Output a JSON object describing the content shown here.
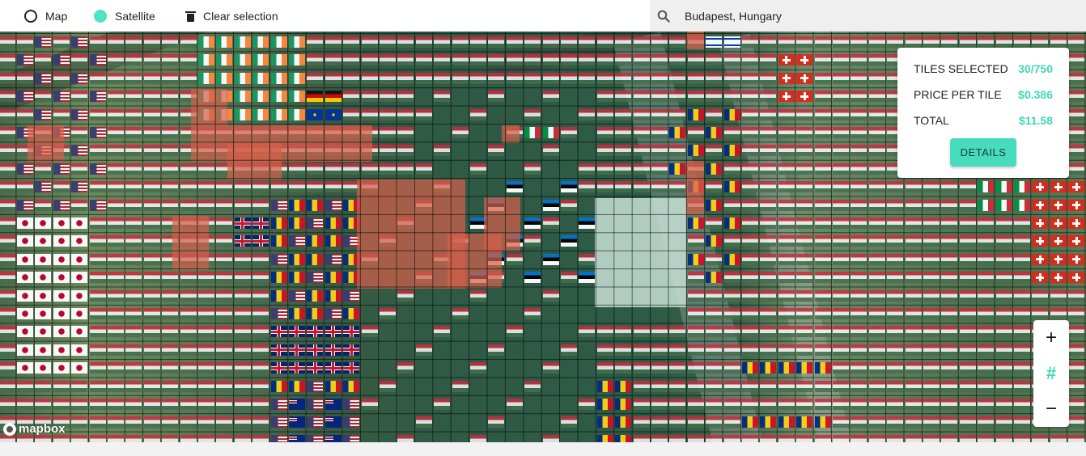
{
  "toolbar": {
    "modes": [
      {
        "label": "Map",
        "selected": false
      },
      {
        "label": "Satellite",
        "selected": true
      }
    ],
    "clear_label": "Clear selection",
    "accent": "#4fe3c1"
  },
  "search": {
    "value": "Budapest, Hungary",
    "icon": "search-icon"
  },
  "panel": {
    "rows": [
      {
        "label": "TILES SELECTED",
        "value": "30/750"
      },
      {
        "label": "PRICE PER TILE",
        "value": "$0.386"
      },
      {
        "label": "TOTAL",
        "value": "$11.58"
      }
    ],
    "details_label": "DETAILS"
  },
  "zoom": {
    "zoom_in": "+",
    "grid": "#",
    "zoom_out": "−"
  },
  "attribution": "mapbox",
  "colors": {
    "accent": "#47dcbe",
    "value_text": "#3fd8b5",
    "owned_tiles": "#d25f4b",
    "selected_tiles": "#c3dcd2"
  }
}
